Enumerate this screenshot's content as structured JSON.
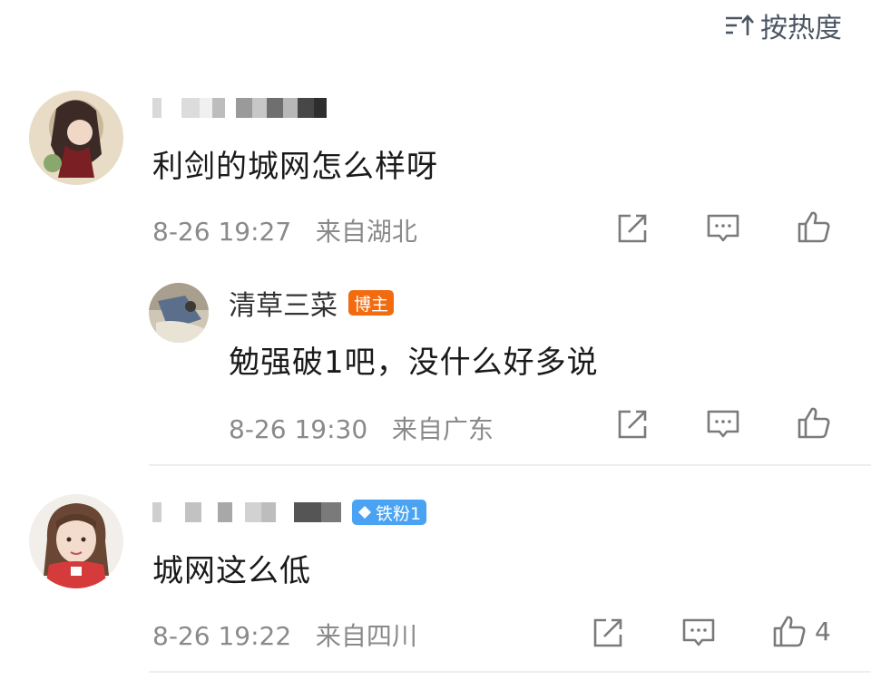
{
  "sort": {
    "label": "按热度"
  },
  "comments": [
    {
      "text": "利剑的城网怎么样呀",
      "time": "8-26 19:27",
      "location": "来自湖北",
      "reply": {
        "user": "清草三菜",
        "badge": "博主",
        "text": "勉强破1吧，没什么好多说",
        "time": "8-26 19:30",
        "location": "来自广东"
      }
    },
    {
      "badge": "铁粉1",
      "text": "城网这么低",
      "time": "8-26 19:22",
      "location": "来自四川",
      "like_count": "4"
    }
  ],
  "colors": {
    "accent_orange": "#f26b0f",
    "fan_badge_blue": "#4aa3f2",
    "meta_gray": "#8a8a8a"
  }
}
